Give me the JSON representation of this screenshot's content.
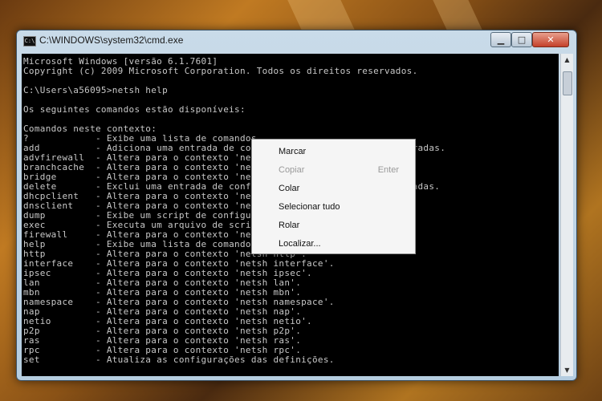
{
  "window": {
    "title": "C:\\WINDOWS\\system32\\cmd.exe",
    "icon_text": "C:\\",
    "min_glyph": "▁",
    "max_glyph": "□",
    "close_glyph": "✕"
  },
  "console": {
    "lines": [
      "Microsoft Windows [versão 6.1.7601]",
      "Copyright (c) 2009 Microsoft Corporation. Todos os direitos reservados.",
      "",
      "C:\\Users\\a56095>netsh help",
      "",
      "Os seguintes comandos estão disponíveis:",
      "",
      "Comandos neste contexto:",
      "?            - Exibe uma lista de comandos.",
      "add          - Adiciona uma entrada de configuração a uma lista de entradas.",
      "advfirewall  - Altera para o contexto 'netsh advfirewall'.",
      "branchcache  - Altera para o contexto 'netsh branchcache'.",
      "bridge       - Altera para o contexto 'netsh bridge'.",
      "delete       - Exclui uma entrada de configuração de uma lista de entradas.",
      "dhcpclient   - Altera para o contexto 'netsh dhcpclient'.",
      "dnsclient    - Altera para o contexto 'netsh dnsclient'.",
      "dump         - Exibe um script de configuração.",
      "exec         - Executa um arquivo de script.",
      "firewall     - Altera para o contexto 'netsh firewall'.",
      "help         - Exibe uma lista de comandos.",
      "http         - Altera para o contexto 'netsh http'.",
      "interface    - Altera para o contexto 'netsh interface'.",
      "ipsec        - Altera para o contexto 'netsh ipsec'.",
      "lan          - Altera para o contexto 'netsh lan'.",
      "mbn          - Altera para o contexto 'netsh mbn'.",
      "namespace    - Altera para o contexto 'netsh namespace'.",
      "nap          - Altera para o contexto 'netsh nap'.",
      "netio        - Altera para o contexto 'netsh netio'.",
      "p2p          - Altera para o contexto 'netsh p2p'.",
      "ras          - Altera para o contexto 'netsh ras'.",
      "rpc          - Altera para o contexto 'netsh rpc'.",
      "set          - Atualiza as configurações das definições."
    ]
  },
  "scrollbar": {
    "up_glyph": "▲",
    "down_glyph": "▼"
  },
  "context_menu": {
    "items": [
      {
        "label": "Marcar",
        "shortcut": "",
        "disabled": false
      },
      {
        "label": "Copiar",
        "shortcut": "Enter",
        "disabled": true
      },
      {
        "label": "Colar",
        "shortcut": "",
        "disabled": false
      },
      {
        "label": "Selecionar tudo",
        "shortcut": "",
        "disabled": false
      },
      {
        "label": "Rolar",
        "shortcut": "",
        "disabled": false
      },
      {
        "label": "Localizar...",
        "shortcut": "",
        "disabled": false
      }
    ]
  }
}
